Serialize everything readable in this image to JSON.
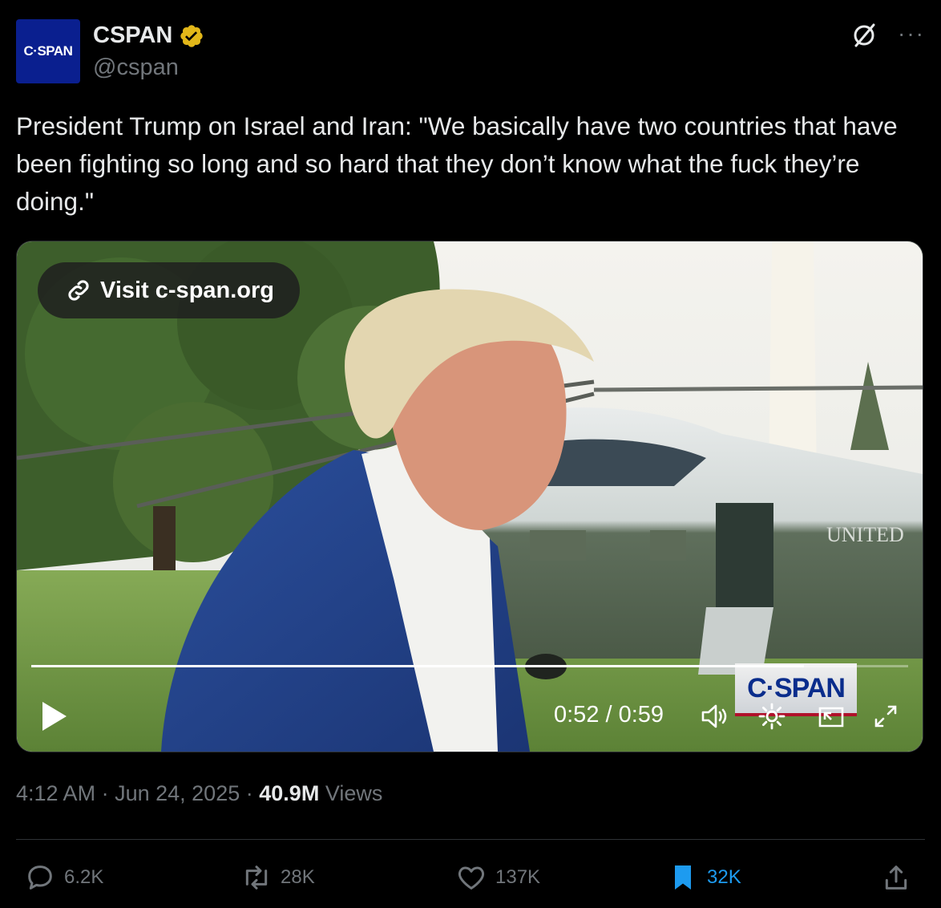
{
  "author": {
    "avatar_text": "C·SPAN",
    "name": "CSPAN",
    "handle": "@cspan",
    "verified_badge": "gold-check-icon"
  },
  "header_icons": {
    "grok": "grok-icon",
    "more": "···"
  },
  "tweet": {
    "text": "President Trump on Israel and Iran: \"We basically have two countries that have been fighting so long and so hard that they don’t know what the fuck they’re doing.\""
  },
  "video": {
    "visit_link_label": "Visit c-span.org",
    "time_display": "0:52 / 0:59",
    "progress_fraction": 0.881,
    "watermark_text": "C·SPAN",
    "aircraft_text": "UNITED",
    "controls": [
      "play-icon",
      "volume-icon",
      "settings-gear-icon",
      "picture-in-picture-icon",
      "fullscreen-icon"
    ]
  },
  "meta": {
    "time": "4:12 AM",
    "separator": "·",
    "date": "Jun 24, 2025",
    "views_count": "40.9M",
    "views_label": "Views"
  },
  "actions": {
    "replies": "6.2K",
    "reposts": "28K",
    "likes": "137K",
    "bookmarks": "32K"
  },
  "colors": {
    "background": "#000000",
    "text": "#e7e9ea",
    "secondary_text": "#71767b",
    "bookmark_active": "#1d9bf0",
    "verified_gold": "#e2b719",
    "avatar_blue": "#0a1f8f"
  }
}
